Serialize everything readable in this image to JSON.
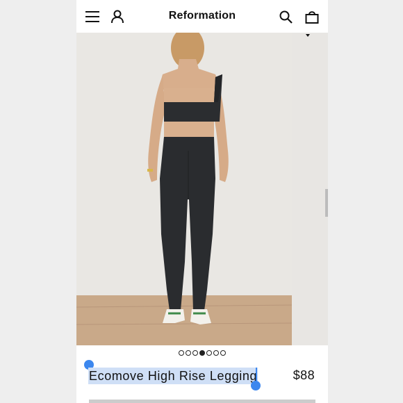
{
  "header": {
    "brand": "Reformation",
    "icons": [
      "menu-icon",
      "account-icon",
      "search-icon",
      "bag-icon"
    ]
  },
  "gallery": {
    "image_count": 7,
    "active_index": 4
  },
  "product": {
    "name": "Ecomove High Rise Legging",
    "price": "$88",
    "name_selected": true
  },
  "colors": {
    "selection_highlight": "#cfdff6",
    "selection_handle": "#3c87ee",
    "text": "#111111"
  }
}
